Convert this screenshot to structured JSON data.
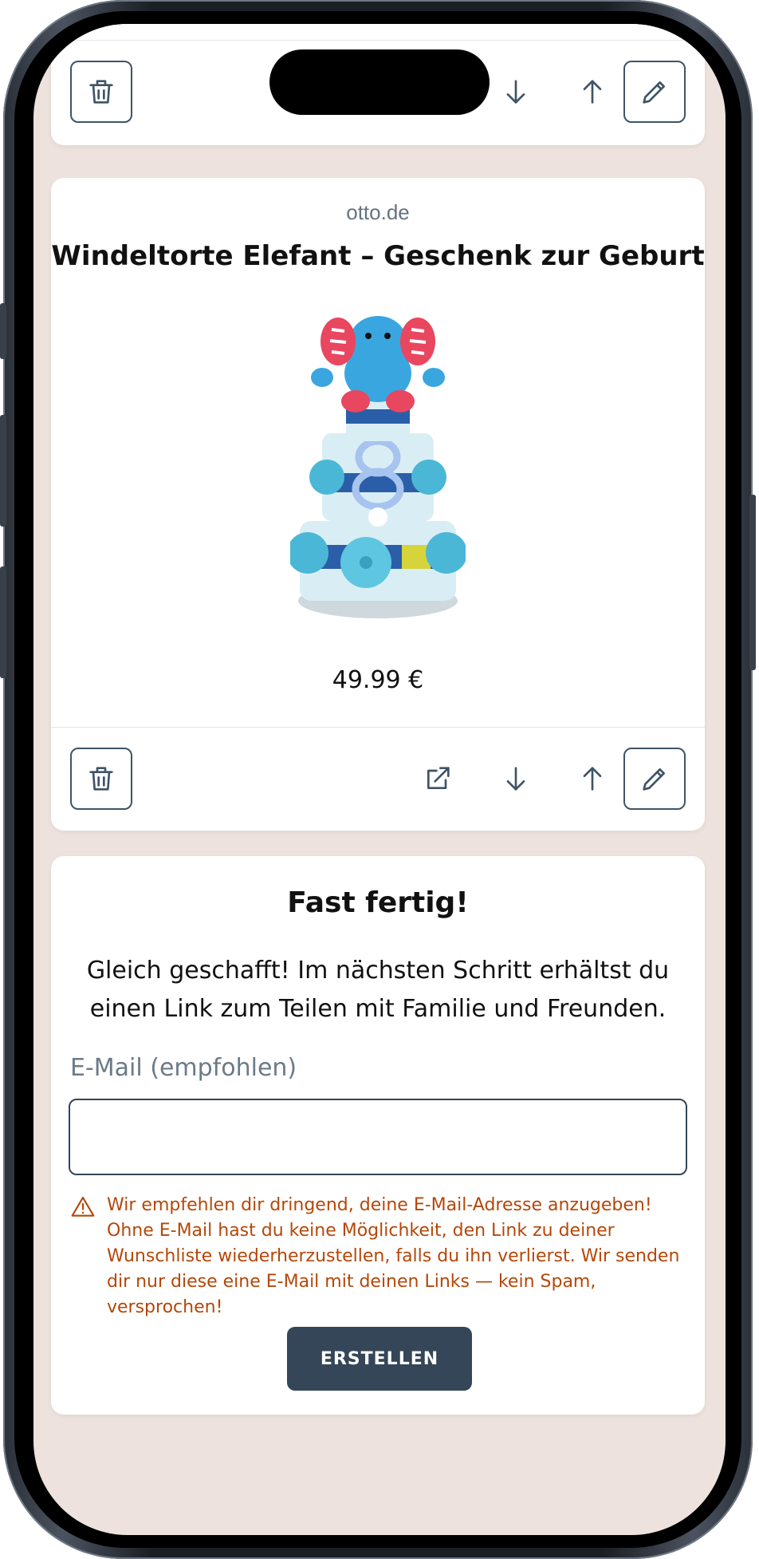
{
  "top_card": {
    "actions": {
      "delete_icon": "trash-icon",
      "down_icon": "arrow-down-icon",
      "up_icon": "arrow-up-icon",
      "edit_icon": "pencil-icon"
    }
  },
  "product": {
    "shop": "otto.de",
    "title": "Windeltorte Elefant – Geschenk zur Geburt",
    "price": "49.99 €",
    "image": "diaper-cake-elephant-image",
    "actions": {
      "delete_icon": "trash-icon",
      "open_icon": "external-link-icon",
      "down_icon": "arrow-down-icon",
      "up_icon": "arrow-up-icon",
      "edit_icon": "pencil-icon"
    }
  },
  "finish": {
    "title": "Fast fertig!",
    "text": "Gleich geschafft! Im nächsten Schritt erhältst du einen Link zum Teilen mit Familie und Freunden.",
    "email_label": "E-Mail (empfohlen)",
    "email_value": "",
    "warning": "Wir empfehlen dir dringend, deine E-Mail-Adresse anzugeben! Ohne E-Mail hast du keine Möglichkeit, den Link zu deiner Wunschliste wiederherzustellen, falls du ihn verlierst. Wir senden dir nur diese eine E-Mail mit deinen Links — kein Spam, versprochen!",
    "create_button": "ERSTELLEN"
  },
  "colors": {
    "background": "#ede2dd",
    "primary": "#344657",
    "warning": "#b54708",
    "muted": "#667380"
  }
}
